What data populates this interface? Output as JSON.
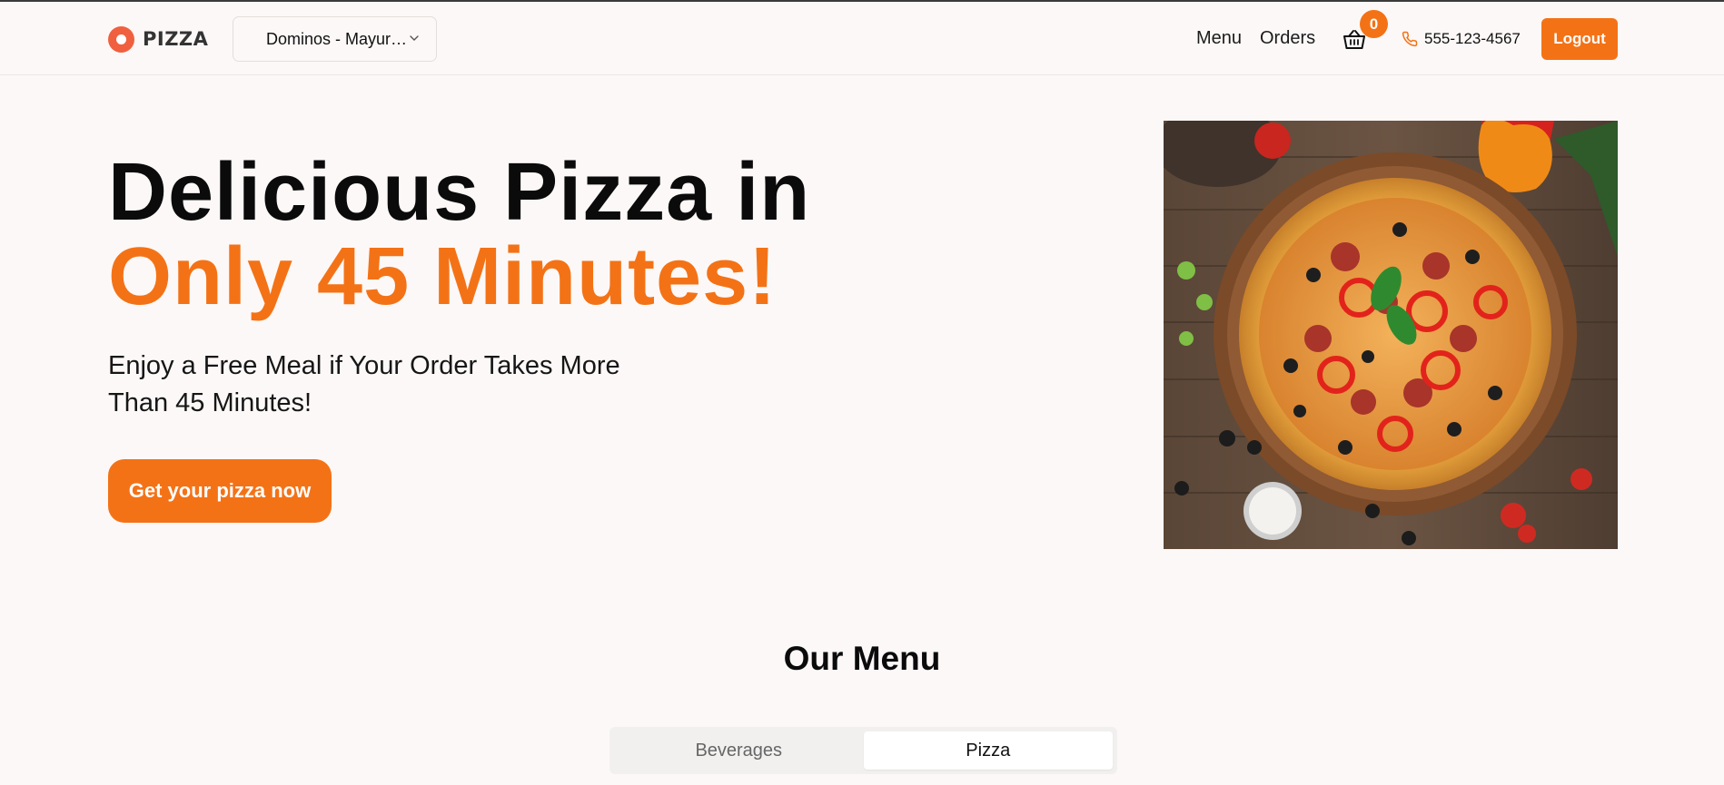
{
  "header": {
    "logo_text": "PIZZA",
    "store": "Dominos - Mayur…",
    "nav": {
      "menu": "Menu",
      "orders": "Orders"
    },
    "cart_count": "0",
    "phone": "555-123-4567",
    "logout": "Logout"
  },
  "hero": {
    "title_line1": "Delicious Pizza in",
    "title_line2": "Only 45 Minutes!",
    "subtitle": "Enjoy a Free Meal if Your Order Takes More Than 45 Minutes!",
    "cta": "Get your pizza now"
  },
  "menu": {
    "title": "Our Menu",
    "tabs": [
      {
        "label": "Beverages",
        "active": false
      },
      {
        "label": "Pizza",
        "active": true
      }
    ]
  },
  "colors": {
    "accent": "#f47216",
    "logo": "#f0603f",
    "background": "#fcf8f7"
  }
}
